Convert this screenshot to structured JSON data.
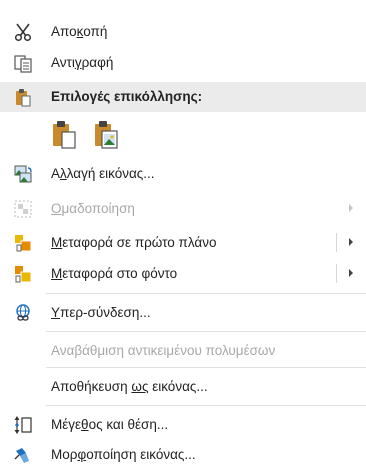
{
  "menu": {
    "cut": {
      "pre": "Απο",
      "key": "κ",
      "post": "οπή",
      "icon": "scissors-icon"
    },
    "copy": {
      "pre": "Αντι",
      "key": "γ",
      "post": "ραφή",
      "icon": "copy-icon"
    },
    "paste_options": {
      "label": "Επιλογές επικόλλησης:",
      "icon": "paste-icon"
    },
    "paste_buttons": [
      {
        "name": "paste-keep-source-icon"
      },
      {
        "name": "paste-picture-icon"
      }
    ],
    "change_picture": {
      "pre": "Α",
      "key": "λ",
      "post": "λαγή εικόνας...",
      "icon": "change-picture-icon"
    },
    "group": {
      "pre": "",
      "key": "Ο",
      "post": "μαδοποίηση",
      "icon": "group-icon",
      "disabled": true
    },
    "bring_front": {
      "pre": "",
      "key": "Μ",
      "post": "εταφορά σε πρώτο πλάνο",
      "icon": "bring-to-front-icon"
    },
    "send_back": {
      "pre": "",
      "key": "Μ",
      "post": "εταφορά στο φόντο",
      "icon": "send-to-back-icon"
    },
    "hyperlink": {
      "pre": "",
      "key": "Υ",
      "post": "περ-σύνδεση...",
      "icon": "hyperlink-icon"
    },
    "update_media": {
      "label": "Αναβάθμιση αντικειμένου πολυμέσων",
      "disabled": true
    },
    "save_as_picture": {
      "pre": "Αποθήκευση ",
      "key": "ως",
      "post": " εικόνας...",
      "icon": ""
    },
    "size_position": {
      "pre": "Μέγε",
      "key": "θ",
      "post": "ος και θέση...",
      "icon": "size-position-icon"
    },
    "format_picture": {
      "pre": "Μορ",
      "key": "φ",
      "post": "οποίηση εικόνας...",
      "icon": "format-picture-icon"
    }
  }
}
